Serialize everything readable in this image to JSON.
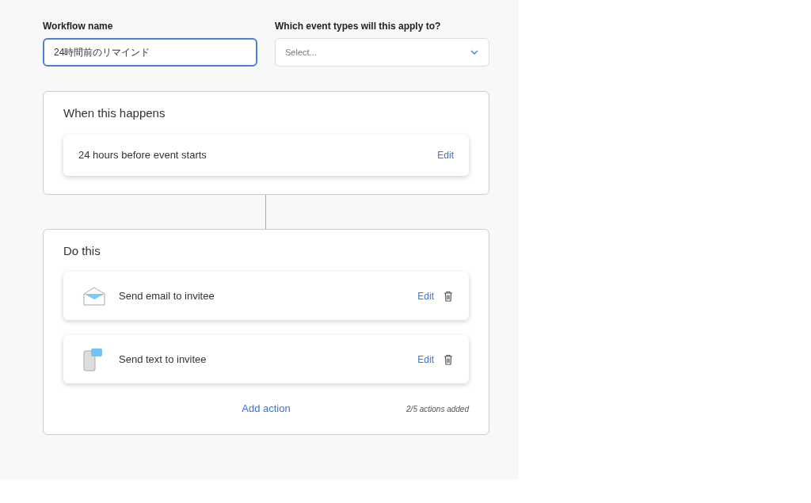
{
  "workflow_name": {
    "label": "Workflow name",
    "value": "24時間前のリマインド"
  },
  "event_types": {
    "label": "Which event types will this apply to?",
    "placeholder": "Select..."
  },
  "trigger": {
    "title": "When this happens",
    "item": {
      "text": "24 hours before event starts",
      "edit": "Edit"
    }
  },
  "actions": {
    "title": "Do this",
    "items": [
      {
        "kind": "email",
        "text": "Send email to invitee",
        "edit": "Edit"
      },
      {
        "kind": "sms",
        "text": "Send text to invitee",
        "edit": "Edit"
      }
    ],
    "add": "Add action",
    "count": "2/5 actions added"
  }
}
